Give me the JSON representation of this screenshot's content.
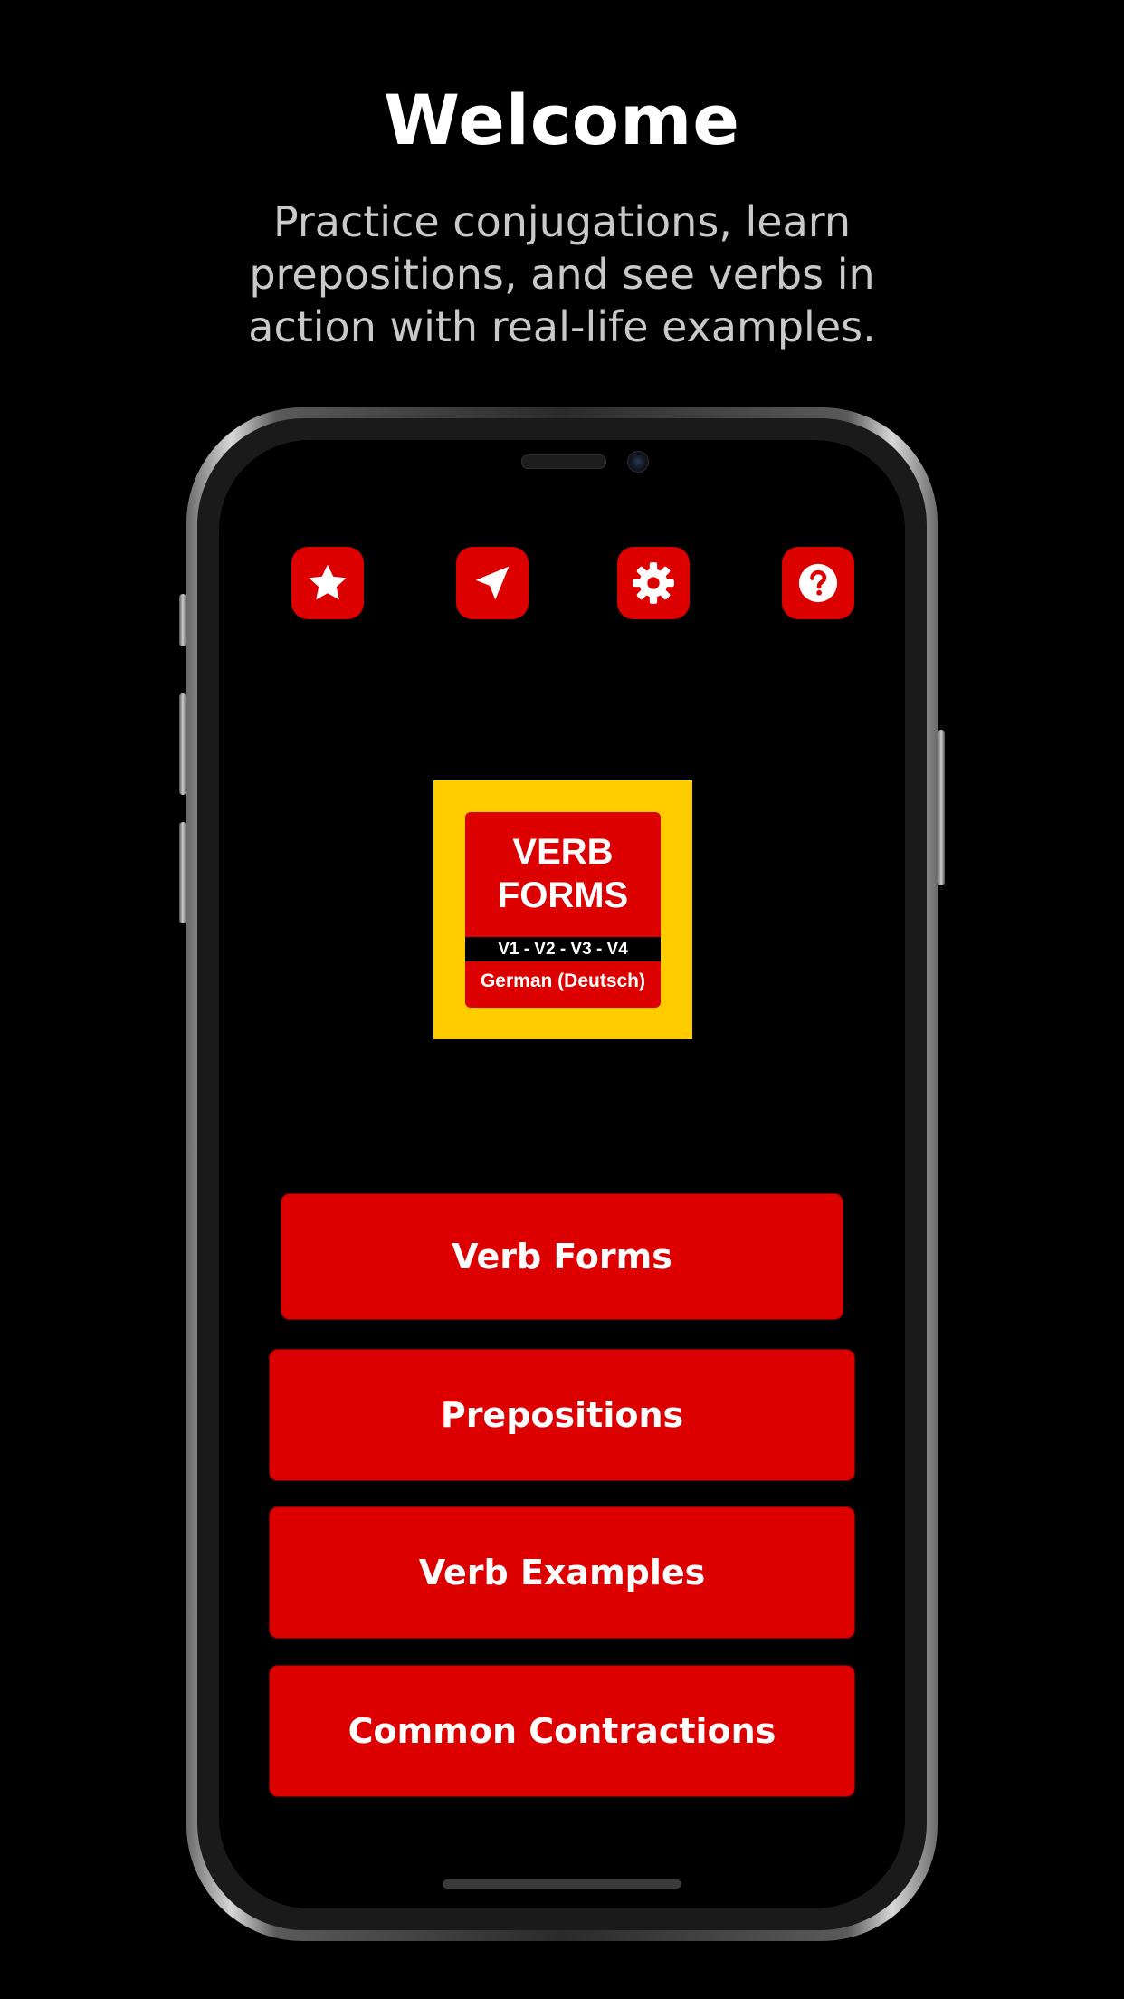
{
  "header": {
    "title": "Welcome",
    "subtitle": "Practice conjugations, learn prepositions, and see verbs in action with real-life examples."
  },
  "toolbar": {
    "icons": [
      {
        "name": "star-icon",
        "label": "Favorites"
      },
      {
        "name": "navigation-arrow-icon",
        "label": "Navigate"
      },
      {
        "name": "gear-icon",
        "label": "Settings"
      },
      {
        "name": "help-icon",
        "label": "Help"
      }
    ]
  },
  "logo": {
    "title_line1": "VERB",
    "title_line2": "FORMS",
    "forms_strip": "V1 - V2 - V3 - V4",
    "language": "German (Deutsch)"
  },
  "menu": {
    "items": [
      {
        "label": "Verb Forms"
      },
      {
        "label": "Prepositions"
      },
      {
        "label": "Verb Examples"
      },
      {
        "label": "Common Contractions"
      }
    ]
  },
  "colors": {
    "background": "#000000",
    "accent_red": "#dd0000",
    "logo_yellow": "#ffcc00",
    "subtitle_gray": "#c9c9c9"
  }
}
